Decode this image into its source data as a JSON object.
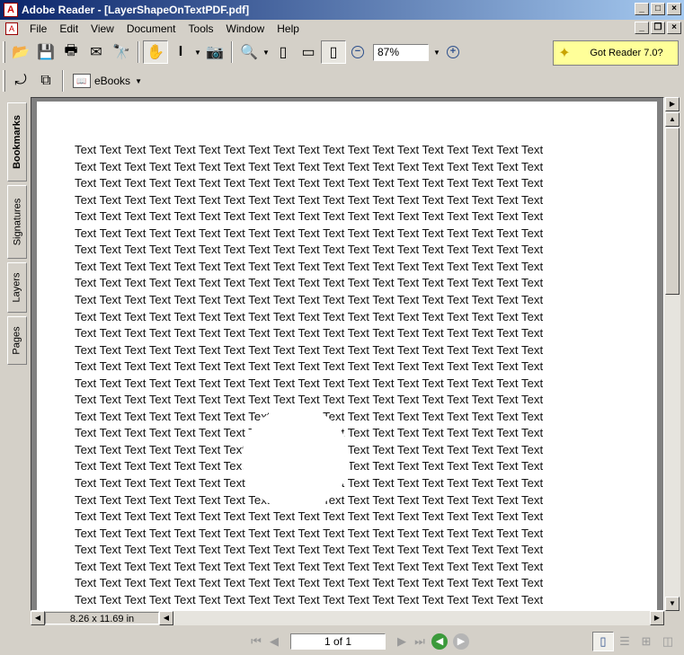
{
  "window": {
    "title": "Adobe Reader - [LayerShapeOnTextPDF.pdf]",
    "app_icon": "adobe-icon"
  },
  "menu": [
    "File",
    "Edit",
    "View",
    "Document",
    "Tools",
    "Window",
    "Help"
  ],
  "toolbar": {
    "zoom_value": "87%",
    "promo_label": "Got Reader 7.0?",
    "ebooks_label": "eBooks"
  },
  "nav_tabs": [
    "Bookmarks",
    "Signatures",
    "Layers",
    "Pages"
  ],
  "document": {
    "text_word": "Text",
    "line_count": 28,
    "words_per_line": 19
  },
  "hscroll": {
    "page_size": "8.26 x 11.69 in"
  },
  "status": {
    "page_indicator": "1 of 1"
  }
}
